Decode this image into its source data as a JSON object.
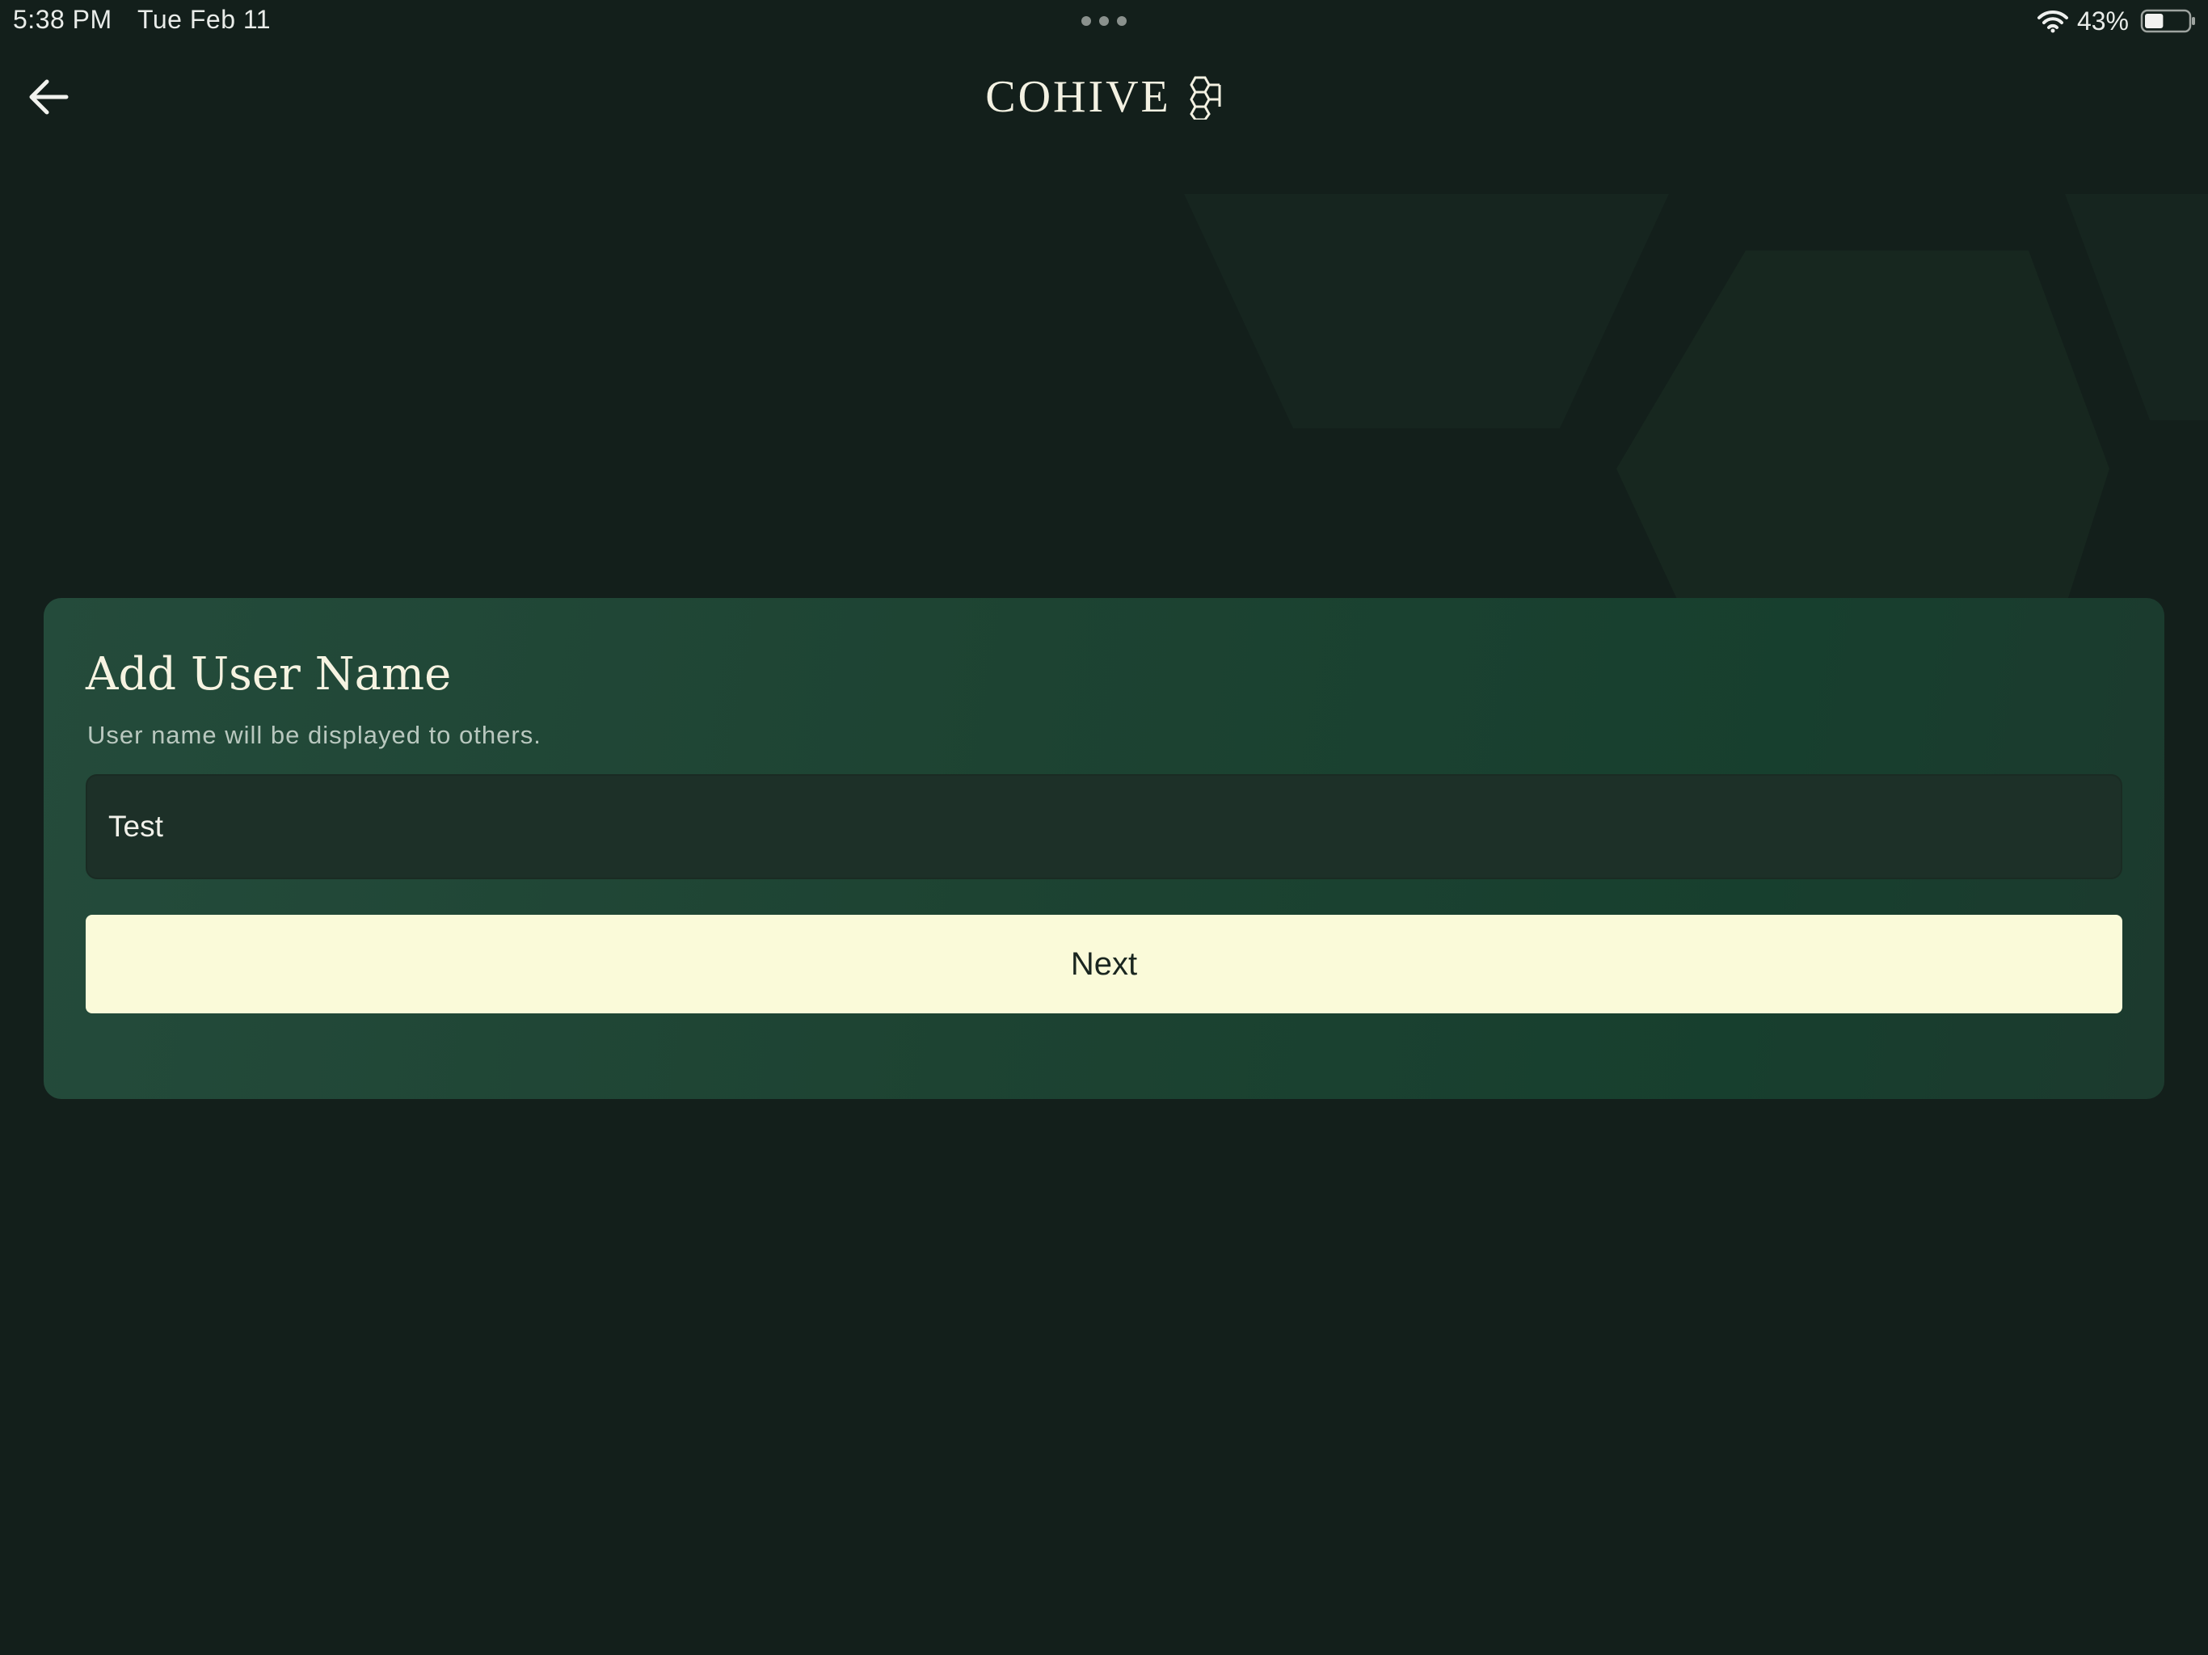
{
  "status_bar": {
    "time": "5:38 PM",
    "date": "Tue Feb 11",
    "battery_percent": "43%",
    "battery_level": 0.43,
    "icons": [
      "wifi-icon",
      "battery-icon",
      "multitask-dots-icon"
    ]
  },
  "nav": {
    "back_icon": "arrow-left-icon",
    "brand_name": "COHIVE",
    "brand_icon": "cohive-logo-icon"
  },
  "form": {
    "title": "Add User Name",
    "subtitle": "User name will be displayed to others.",
    "username_value": "Test",
    "next_label": "Next"
  },
  "colors": {
    "background": "#131f1b",
    "card": "#1d4332",
    "input": "#1d3028",
    "button": "#fafad9",
    "text_light": "#f6f3e1"
  }
}
